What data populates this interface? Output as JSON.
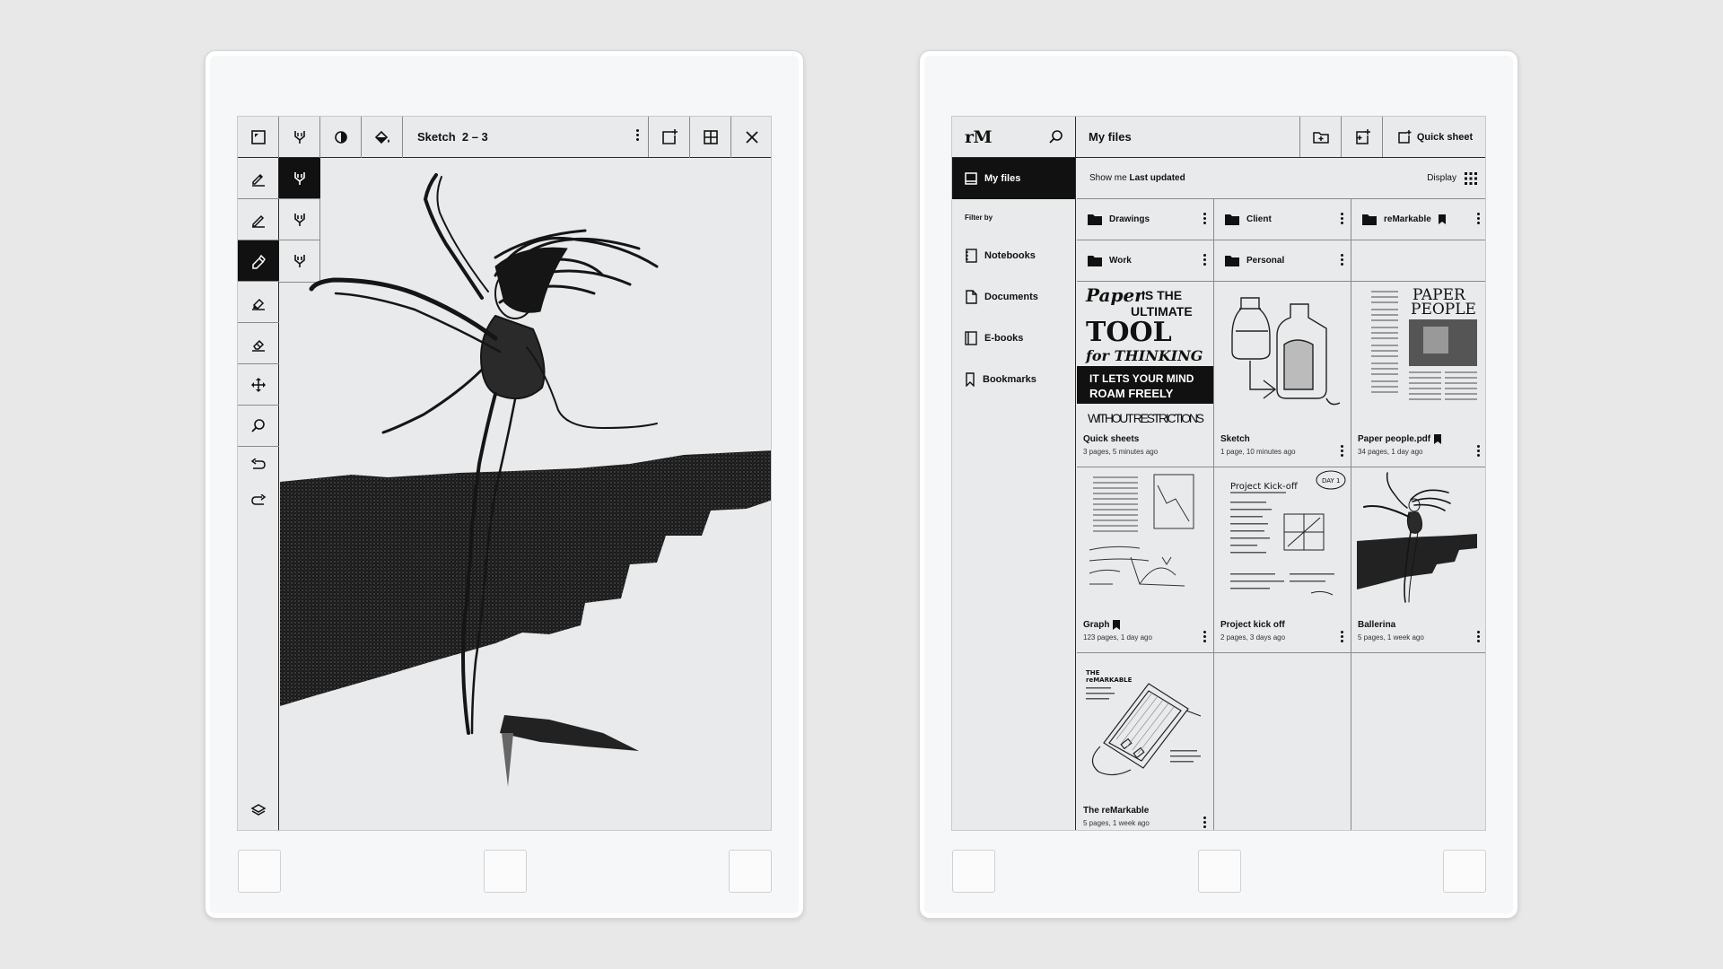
{
  "left_device": {
    "toolbar": {
      "doc_title": "Sketch",
      "page_indicator": "2 – 3"
    },
    "tools": {
      "side_icons": [
        "fineliner-icon",
        "pencil-icon",
        "marker-icon",
        "highlighter-icon",
        "eraser-icon",
        "move-icon",
        "zoom-icon",
        "undo-icon",
        "redo-icon"
      ],
      "active_tool_index": 2,
      "active_subtool_index": 0
    }
  },
  "right_device": {
    "logo": "rM",
    "title": "My files",
    "quick_sheet_label": "Quick sheet",
    "sidebar": {
      "my_files_label": "My files",
      "filter_label": "Filter by",
      "items": [
        {
          "label": "Notebooks",
          "icon": "notebook-icon"
        },
        {
          "label": "Documents",
          "icon": "document-icon"
        },
        {
          "label": "E-books",
          "icon": "ebook-icon"
        },
        {
          "label": "Bookmarks",
          "icon": "bookmark-icon"
        }
      ]
    },
    "sort": {
      "prefix": "Show me",
      "value": "Last updated",
      "display_label": "Display"
    },
    "folders": [
      {
        "name": "Drawings",
        "bookmarked": false
      },
      {
        "name": "Client",
        "bookmarked": false
      },
      {
        "name": "reMarkable",
        "bookmarked": true
      },
      {
        "name": "Work",
        "bookmarked": false
      },
      {
        "name": "Personal",
        "bookmarked": false
      }
    ],
    "documents": [
      {
        "name": "Quick sheets",
        "meta": "3 pages, 5 minutes ago",
        "bookmarked": false,
        "menu": false
      },
      {
        "name": "Sketch",
        "meta": "1 page, 10 minutes ago",
        "bookmarked": false,
        "menu": true
      },
      {
        "name": "Paper people.pdf",
        "meta": "34 pages, 1 day ago",
        "bookmarked": true,
        "menu": true
      },
      {
        "name": "Graph",
        "meta": "123 pages, 1 day ago",
        "bookmarked": true,
        "menu": true
      },
      {
        "name": "Project kick off",
        "meta": "2 pages, 3 days ago",
        "bookmarked": false,
        "menu": true
      },
      {
        "name": "Ballerina",
        "meta": "5 pages, 1 week ago",
        "bookmarked": false,
        "menu": true
      },
      {
        "name": "The reMarkable",
        "meta": "5 pages, 1 week ago",
        "bookmarked": false,
        "menu": true
      }
    ],
    "thumbnail_text": {
      "quick_sheets": [
        "Paper",
        "IS THE",
        "ULTIMATE",
        "TOOL",
        "for THINKING",
        "IT LETS YOUR MIND",
        "ROAM FREELY",
        "WITHOUT RESTRICTIONS"
      ],
      "paper_people": [
        "PAPER",
        "PEOPLE"
      ],
      "project_kick_off": [
        "Project Kick-off",
        "DAY 1"
      ],
      "the_remarkable": [
        "THE",
        "reMARKABLE"
      ]
    }
  }
}
